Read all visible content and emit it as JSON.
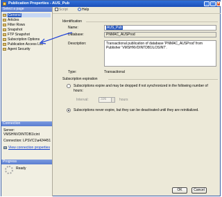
{
  "window": {
    "title": "Publication Properties - AUS_Pub"
  },
  "left_pane": {
    "select_page_header": "Select a page",
    "pages": [
      {
        "label": "General",
        "icon": "page-icon",
        "selected": true
      },
      {
        "label": "Articles",
        "icon": "page-icon"
      },
      {
        "label": "Filter Rows",
        "icon": "page-icon"
      },
      {
        "label": "Snapshot",
        "icon": "page-icon"
      },
      {
        "label": "FTP Snapshot",
        "icon": "page-icon"
      },
      {
        "label": "Subscription Options",
        "icon": "page-icon"
      },
      {
        "label": "Publication Access List",
        "icon": "page-icon"
      },
      {
        "label": "Agent Security",
        "icon": "page-icon"
      }
    ],
    "connection_header": "Connection",
    "server_label": "Server:",
    "server_value": "VMSHNVDINTDB1\\cint",
    "connection_label": "Connection: LPSVC1\\a424451",
    "view_connection_link": "View connection properties",
    "progress_header": "Progress",
    "progress_status": "Ready"
  },
  "toolbar": {
    "script_label": "Script",
    "help_label": "Help"
  },
  "main": {
    "identification_header": "Identification",
    "name_label": "Name:",
    "name_value": "AUS_Pub",
    "database_label": "Database:",
    "database_value": "PNMAC_AUSProd",
    "description_label": "Description:",
    "description_line1": "Transactional publication of database 'PNMAC_AUSProd' from",
    "description_line2": "Publisher 'VMSHNVDINTDB1\\LOSINT'.",
    "type_label": "Type:",
    "type_value": "Transactional",
    "expiration_header": "Subscription expiration",
    "radio1_line1": "Subscriptions expire and may be dropped if not synchronized in the following number of",
    "radio1_line2": "hours:",
    "interval_label": "Interval:",
    "interval_value": "336",
    "interval_unit": "hours",
    "radio2_label": "Subscriptions never expire, but they can be deactivated until they are reinitialized.",
    "radio1_selected": false,
    "radio2_selected": true
  },
  "footer": {
    "ok_label": "OK",
    "cancel_label": "Cancel"
  },
  "colors": {
    "title_bar": "#1c4fb8",
    "section_header": "#5a7dd0",
    "selection": "#2c5bbf",
    "annotation_arrow": "#1b3fd8"
  }
}
